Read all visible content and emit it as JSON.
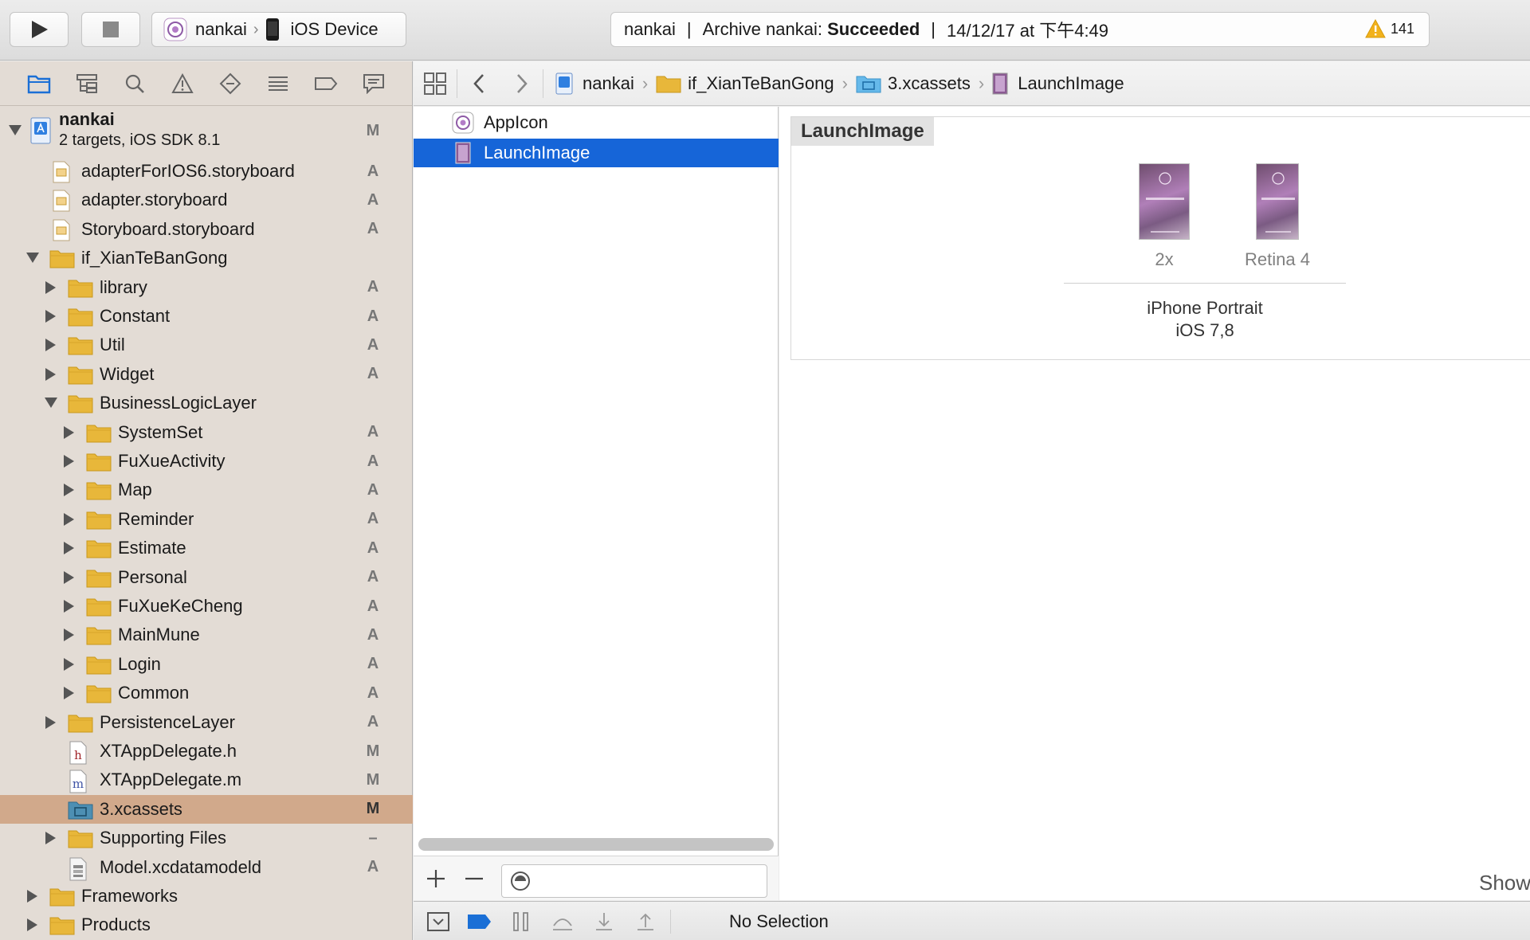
{
  "toolbar": {
    "scheme": "nankai",
    "device": "iOS Device",
    "activity": {
      "project": "nankai",
      "archive_prefix": "Archive nankai:",
      "archive_status": "Succeeded",
      "date": "14/12/17 at 下午4:49",
      "warning_count": "141"
    }
  },
  "navigator": {
    "tabs": [
      "project-navigator-icon",
      "symbol-navigator-icon",
      "find-navigator-icon",
      "issue-navigator-icon",
      "test-navigator-icon",
      "debug-navigator-icon",
      "breakpoint-navigator-icon",
      "report-navigator-icon"
    ],
    "project": {
      "name": "nankai",
      "subtitle": "2 targets, iOS SDK 8.1",
      "status": "M"
    },
    "items": [
      {
        "label": "adapterForIOS6.storyboard",
        "status": "A"
      },
      {
        "label": "adapter.storyboard",
        "status": "A"
      },
      {
        "label": "Storyboard.storyboard",
        "status": "A"
      },
      {
        "label": "if_XianTeBanGong",
        "status": ""
      },
      {
        "label": "library",
        "status": "A"
      },
      {
        "label": "Constant",
        "status": "A"
      },
      {
        "label": "Util",
        "status": "A"
      },
      {
        "label": "Widget",
        "status": "A"
      },
      {
        "label": "BusinessLogicLayer",
        "status": ""
      },
      {
        "label": "SystemSet",
        "status": "A"
      },
      {
        "label": "FuXueActivity",
        "status": "A"
      },
      {
        "label": "Map",
        "status": "A"
      },
      {
        "label": "Reminder",
        "status": "A"
      },
      {
        "label": "Estimate",
        "status": "A"
      },
      {
        "label": "Personal",
        "status": "A"
      },
      {
        "label": "FuXueKeCheng",
        "status": "A"
      },
      {
        "label": "MainMune",
        "status": "A"
      },
      {
        "label": "Login",
        "status": "A"
      },
      {
        "label": "Common",
        "status": "A"
      },
      {
        "label": "PersistenceLayer",
        "status": "A"
      },
      {
        "label": "XTAppDelegate.h",
        "status": "M"
      },
      {
        "label": "XTAppDelegate.m",
        "status": "M"
      },
      {
        "label": "3.xcassets",
        "status": "M"
      },
      {
        "label": "Supporting Files",
        "status": "–"
      },
      {
        "label": "Model.xcdatamodeld",
        "status": "A"
      },
      {
        "label": "Frameworks",
        "status": ""
      },
      {
        "label": "Products",
        "status": ""
      }
    ]
  },
  "jumpbar": {
    "crumbs": [
      "nankai",
      "if_XianTeBanGong",
      "3.xcassets",
      "LaunchImage"
    ]
  },
  "assets": {
    "items": [
      "AppIcon",
      "LaunchImage"
    ],
    "selected": "LaunchImage"
  },
  "detail": {
    "set_title": "LaunchImage",
    "slots": [
      "2x",
      "Retina 4"
    ],
    "group_line1": "iPhone Portrait",
    "group_line2": "iOS 7,8",
    "show_label": "Show"
  },
  "debugbar": {
    "status": "No Selection"
  },
  "colors": {
    "navigator_bg": "#e3dcd5",
    "navigator_selection": "#d1a98b",
    "list_selection": "#1665d8",
    "folder_yellow": "#e8b73a",
    "warning": "#f2b21c"
  }
}
